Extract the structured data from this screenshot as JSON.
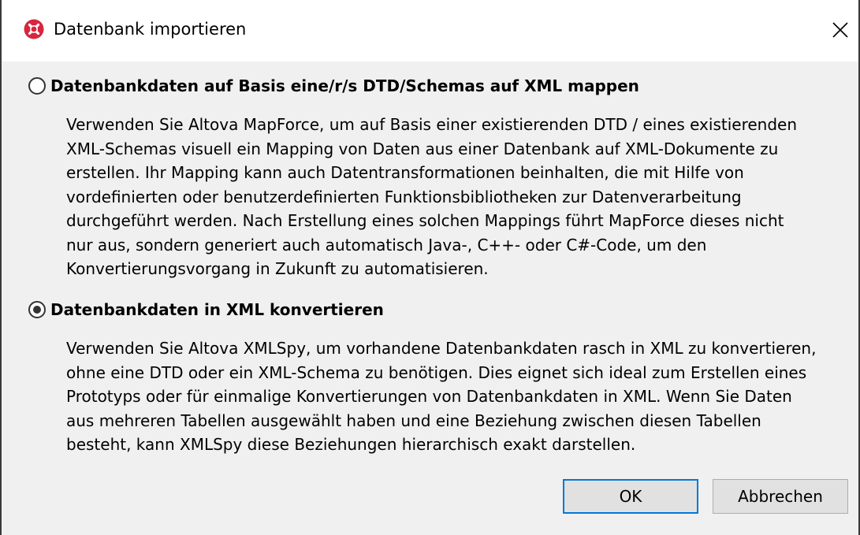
{
  "window": {
    "title": "Datenbank importieren",
    "app_icon": "altova-app-icon",
    "close_icon": "close-icon"
  },
  "options": [
    {
      "label": "Datenbankdaten auf Basis eine/r/s DTD/Schemas auf XML mappen",
      "checked": false,
      "description_lines": [
        "Verwenden Sie Altova MapForce, um auf Basis einer existierenden DTD / eines existierenden",
        "XML-Schemas visuell ein Mapping von Daten aus einer Datenbank auf XML-Dokumente zu",
        "erstellen. Ihr Mapping kann auch Datentransformationen beinhalten, die mit Hilfe von",
        "vordefinierten oder benutzerdefinierten Funktionsbibliotheken zur Datenverarbeitung",
        "durchgeführt werden. Nach Erstellung eines solchen Mappings führt MapForce dieses nicht",
        "nur aus, sondern generiert auch automatisch Java-, C++- oder C#-Code, um den",
        "Konvertierungsvorgang in Zukunft zu automatisieren."
      ]
    },
    {
      "label": "Datenbankdaten in XML konvertieren",
      "checked": true,
      "description_lines": [
        "Verwenden Sie Altova XMLSpy, um vorhandene Datenbankdaten rasch in XML zu konvertieren,",
        "ohne eine DTD oder ein XML-Schema zu benötigen. Dies eignet sich ideal zum Erstellen eines",
        "Prototyps oder für einmalige Konvertierungen von Datenbankdaten in XML. Wenn Sie Daten",
        "aus mehreren Tabellen ausgewählt haben und eine Beziehung zwischen diesen Tabellen",
        "besteht, kann XMLSpy diese Beziehungen hierarchisch exakt darstellen."
      ]
    }
  ],
  "buttons": {
    "ok_label": "OK",
    "cancel_label": "Abbrechen"
  },
  "colors": {
    "default_button_border": "#0078d7",
    "dialog_background": "#f0f0f0",
    "app_icon_red": "#d7263d"
  }
}
